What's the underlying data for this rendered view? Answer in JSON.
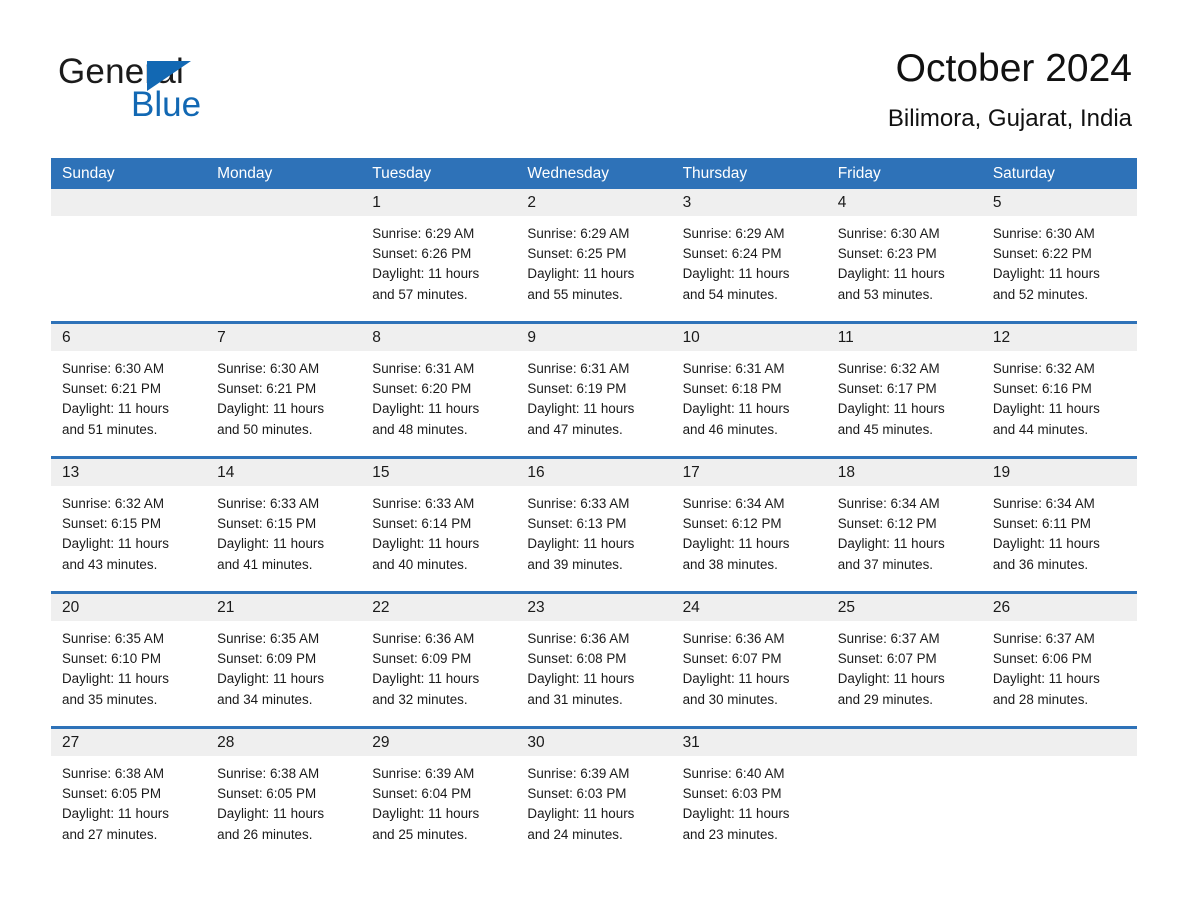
{
  "brand": {
    "word1": "General",
    "word2": "Blue",
    "flag_color": "#1268b3"
  },
  "header": {
    "month_title": "October 2024",
    "location": "Bilimora, Gujarat, India",
    "accent_color": "#2e72b8",
    "band_color": "#efefef"
  },
  "weekdays": [
    "Sunday",
    "Monday",
    "Tuesday",
    "Wednesday",
    "Thursday",
    "Friday",
    "Saturday"
  ],
  "labels": {
    "sunrise_prefix": "Sunrise:",
    "sunset_prefix": "Sunset:",
    "daylight_prefix": "Daylight:"
  },
  "weeks": [
    [
      {
        "day": "",
        "sunrise": "",
        "sunset": "",
        "daylight_1": "",
        "daylight_2": ""
      },
      {
        "day": "",
        "sunrise": "",
        "sunset": "",
        "daylight_1": "",
        "daylight_2": ""
      },
      {
        "day": "1",
        "sunrise": "Sunrise: 6:29 AM",
        "sunset": "Sunset: 6:26 PM",
        "daylight_1": "Daylight: 11 hours",
        "daylight_2": "and 57 minutes."
      },
      {
        "day": "2",
        "sunrise": "Sunrise: 6:29 AM",
        "sunset": "Sunset: 6:25 PM",
        "daylight_1": "Daylight: 11 hours",
        "daylight_2": "and 55 minutes."
      },
      {
        "day": "3",
        "sunrise": "Sunrise: 6:29 AM",
        "sunset": "Sunset: 6:24 PM",
        "daylight_1": "Daylight: 11 hours",
        "daylight_2": "and 54 minutes."
      },
      {
        "day": "4",
        "sunrise": "Sunrise: 6:30 AM",
        "sunset": "Sunset: 6:23 PM",
        "daylight_1": "Daylight: 11 hours",
        "daylight_2": "and 53 minutes."
      },
      {
        "day": "5",
        "sunrise": "Sunrise: 6:30 AM",
        "sunset": "Sunset: 6:22 PM",
        "daylight_1": "Daylight: 11 hours",
        "daylight_2": "and 52 minutes."
      }
    ],
    [
      {
        "day": "6",
        "sunrise": "Sunrise: 6:30 AM",
        "sunset": "Sunset: 6:21 PM",
        "daylight_1": "Daylight: 11 hours",
        "daylight_2": "and 51 minutes."
      },
      {
        "day": "7",
        "sunrise": "Sunrise: 6:30 AM",
        "sunset": "Sunset: 6:21 PM",
        "daylight_1": "Daylight: 11 hours",
        "daylight_2": "and 50 minutes."
      },
      {
        "day": "8",
        "sunrise": "Sunrise: 6:31 AM",
        "sunset": "Sunset: 6:20 PM",
        "daylight_1": "Daylight: 11 hours",
        "daylight_2": "and 48 minutes."
      },
      {
        "day": "9",
        "sunrise": "Sunrise: 6:31 AM",
        "sunset": "Sunset: 6:19 PM",
        "daylight_1": "Daylight: 11 hours",
        "daylight_2": "and 47 minutes."
      },
      {
        "day": "10",
        "sunrise": "Sunrise: 6:31 AM",
        "sunset": "Sunset: 6:18 PM",
        "daylight_1": "Daylight: 11 hours",
        "daylight_2": "and 46 minutes."
      },
      {
        "day": "11",
        "sunrise": "Sunrise: 6:32 AM",
        "sunset": "Sunset: 6:17 PM",
        "daylight_1": "Daylight: 11 hours",
        "daylight_2": "and 45 minutes."
      },
      {
        "day": "12",
        "sunrise": "Sunrise: 6:32 AM",
        "sunset": "Sunset: 6:16 PM",
        "daylight_1": "Daylight: 11 hours",
        "daylight_2": "and 44 minutes."
      }
    ],
    [
      {
        "day": "13",
        "sunrise": "Sunrise: 6:32 AM",
        "sunset": "Sunset: 6:15 PM",
        "daylight_1": "Daylight: 11 hours",
        "daylight_2": "and 43 minutes."
      },
      {
        "day": "14",
        "sunrise": "Sunrise: 6:33 AM",
        "sunset": "Sunset: 6:15 PM",
        "daylight_1": "Daylight: 11 hours",
        "daylight_2": "and 41 minutes."
      },
      {
        "day": "15",
        "sunrise": "Sunrise: 6:33 AM",
        "sunset": "Sunset: 6:14 PM",
        "daylight_1": "Daylight: 11 hours",
        "daylight_2": "and 40 minutes."
      },
      {
        "day": "16",
        "sunrise": "Sunrise: 6:33 AM",
        "sunset": "Sunset: 6:13 PM",
        "daylight_1": "Daylight: 11 hours",
        "daylight_2": "and 39 minutes."
      },
      {
        "day": "17",
        "sunrise": "Sunrise: 6:34 AM",
        "sunset": "Sunset: 6:12 PM",
        "daylight_1": "Daylight: 11 hours",
        "daylight_2": "and 38 minutes."
      },
      {
        "day": "18",
        "sunrise": "Sunrise: 6:34 AM",
        "sunset": "Sunset: 6:12 PM",
        "daylight_1": "Daylight: 11 hours",
        "daylight_2": "and 37 minutes."
      },
      {
        "day": "19",
        "sunrise": "Sunrise: 6:34 AM",
        "sunset": "Sunset: 6:11 PM",
        "daylight_1": "Daylight: 11 hours",
        "daylight_2": "and 36 minutes."
      }
    ],
    [
      {
        "day": "20",
        "sunrise": "Sunrise: 6:35 AM",
        "sunset": "Sunset: 6:10 PM",
        "daylight_1": "Daylight: 11 hours",
        "daylight_2": "and 35 minutes."
      },
      {
        "day": "21",
        "sunrise": "Sunrise: 6:35 AM",
        "sunset": "Sunset: 6:09 PM",
        "daylight_1": "Daylight: 11 hours",
        "daylight_2": "and 34 minutes."
      },
      {
        "day": "22",
        "sunrise": "Sunrise: 6:36 AM",
        "sunset": "Sunset: 6:09 PM",
        "daylight_1": "Daylight: 11 hours",
        "daylight_2": "and 32 minutes."
      },
      {
        "day": "23",
        "sunrise": "Sunrise: 6:36 AM",
        "sunset": "Sunset: 6:08 PM",
        "daylight_1": "Daylight: 11 hours",
        "daylight_2": "and 31 minutes."
      },
      {
        "day": "24",
        "sunrise": "Sunrise: 6:36 AM",
        "sunset": "Sunset: 6:07 PM",
        "daylight_1": "Daylight: 11 hours",
        "daylight_2": "and 30 minutes."
      },
      {
        "day": "25",
        "sunrise": "Sunrise: 6:37 AM",
        "sunset": "Sunset: 6:07 PM",
        "daylight_1": "Daylight: 11 hours",
        "daylight_2": "and 29 minutes."
      },
      {
        "day": "26",
        "sunrise": "Sunrise: 6:37 AM",
        "sunset": "Sunset: 6:06 PM",
        "daylight_1": "Daylight: 11 hours",
        "daylight_2": "and 28 minutes."
      }
    ],
    [
      {
        "day": "27",
        "sunrise": "Sunrise: 6:38 AM",
        "sunset": "Sunset: 6:05 PM",
        "daylight_1": "Daylight: 11 hours",
        "daylight_2": "and 27 minutes."
      },
      {
        "day": "28",
        "sunrise": "Sunrise: 6:38 AM",
        "sunset": "Sunset: 6:05 PM",
        "daylight_1": "Daylight: 11 hours",
        "daylight_2": "and 26 minutes."
      },
      {
        "day": "29",
        "sunrise": "Sunrise: 6:39 AM",
        "sunset": "Sunset: 6:04 PM",
        "daylight_1": "Daylight: 11 hours",
        "daylight_2": "and 25 minutes."
      },
      {
        "day": "30",
        "sunrise": "Sunrise: 6:39 AM",
        "sunset": "Sunset: 6:03 PM",
        "daylight_1": "Daylight: 11 hours",
        "daylight_2": "and 24 minutes."
      },
      {
        "day": "31",
        "sunrise": "Sunrise: 6:40 AM",
        "sunset": "Sunset: 6:03 PM",
        "daylight_1": "Daylight: 11 hours",
        "daylight_2": "and 23 minutes."
      },
      {
        "day": "",
        "sunrise": "",
        "sunset": "",
        "daylight_1": "",
        "daylight_2": ""
      },
      {
        "day": "",
        "sunrise": "",
        "sunset": "",
        "daylight_1": "",
        "daylight_2": ""
      }
    ]
  ]
}
